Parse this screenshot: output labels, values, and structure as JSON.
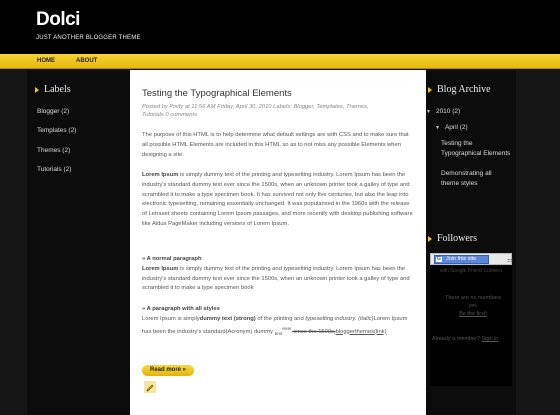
{
  "header": {
    "title": "Dolci",
    "description": "JUST ANOTHER BLOGGER THEME"
  },
  "nav": {
    "items": [
      "HOME",
      "ABOUT"
    ]
  },
  "labels_widget": {
    "title": "Labels",
    "items": [
      "Blogger (2)",
      "Templates (2)",
      "Themes (2)",
      "Tutorials (2)"
    ]
  },
  "post": {
    "title": "Testing the Typographical Elements",
    "meta_line1": "Posted by Pixify at 11:56 AM Friday, April 30, 2010 Labels: Blogger, Templates, Themes,",
    "meta_line2": "Tutorials 0 comments",
    "intro": "The purpose of this HTML is to help determine what default settings are with CSS and to make sure that all possible HTML Elements are included in this HTML so as to not miss any possible Elements when designing a site.",
    "lorem_bold": "Lorem Ipsum",
    "lorem_text": " is simply dummy text of the printing and typesetting industry. Lorem Ipsum has been the industry's standard dummy text ever since the 1500s, when an unknown printer took a galley of type and scrambled it to make a type specimen book. It has survived not only five centuries, but also the leap into electronic typesetting, remaining essentially unchanged. It was popularised in the 1960s with the release of Letraset sheets containing Lorem Ipsum passages, and more recently with desktop publishing software like Aldus PageMaker including versions of Lorem Ipsum.",
    "normal_heading": "» A normal paragraph",
    "normal_lorem_bold": "Lorem Ipsum",
    "normal_text": " is simply dummy text of the printing and typesetting industry. Lorem Ipsum has been the industry's standard dummy text ever since the 1500s, when an unknown printer took a galley of type and scrambled it to make a type specimen book",
    "styles_heading": "» A paragraph with all styles",
    "styles_a": "Lorem Ipsum is simply",
    "styles_strong": "dummy text (strong)",
    "styles_b": " of the printing and ",
    "styles_em": "typesetting industry.",
    "styles_italic": "(italic)",
    "styles_c": "Lorem Ipsum has been the industry's standard(Acronym) dummy ",
    "styles_sub": "text",
    "styles_sup": "ever",
    "styles_strike": " since the 1500s,",
    "styles_link": "bloggerthemes(link)",
    "read_more": "Read more »"
  },
  "archive_widget": {
    "title": "Blog Archive",
    "year": "2010 (2)",
    "month": "April (2)",
    "posts": [
      "Testing the Typographical Elements",
      "Demonstrating all theme styles"
    ]
  },
  "followers_widget": {
    "title": "Followers",
    "join_label": "Join this site",
    "google_label": "with Google Friend Connect",
    "empty_text_1": "There are no members",
    "empty_text_2": "yet.",
    "be_first": "Be the first!",
    "member_q": "Already a member?",
    "sign_in": "Sign in"
  },
  "colors": {
    "accent": "#f2c317",
    "background": "#111111",
    "content_bg": "#ffffff"
  }
}
